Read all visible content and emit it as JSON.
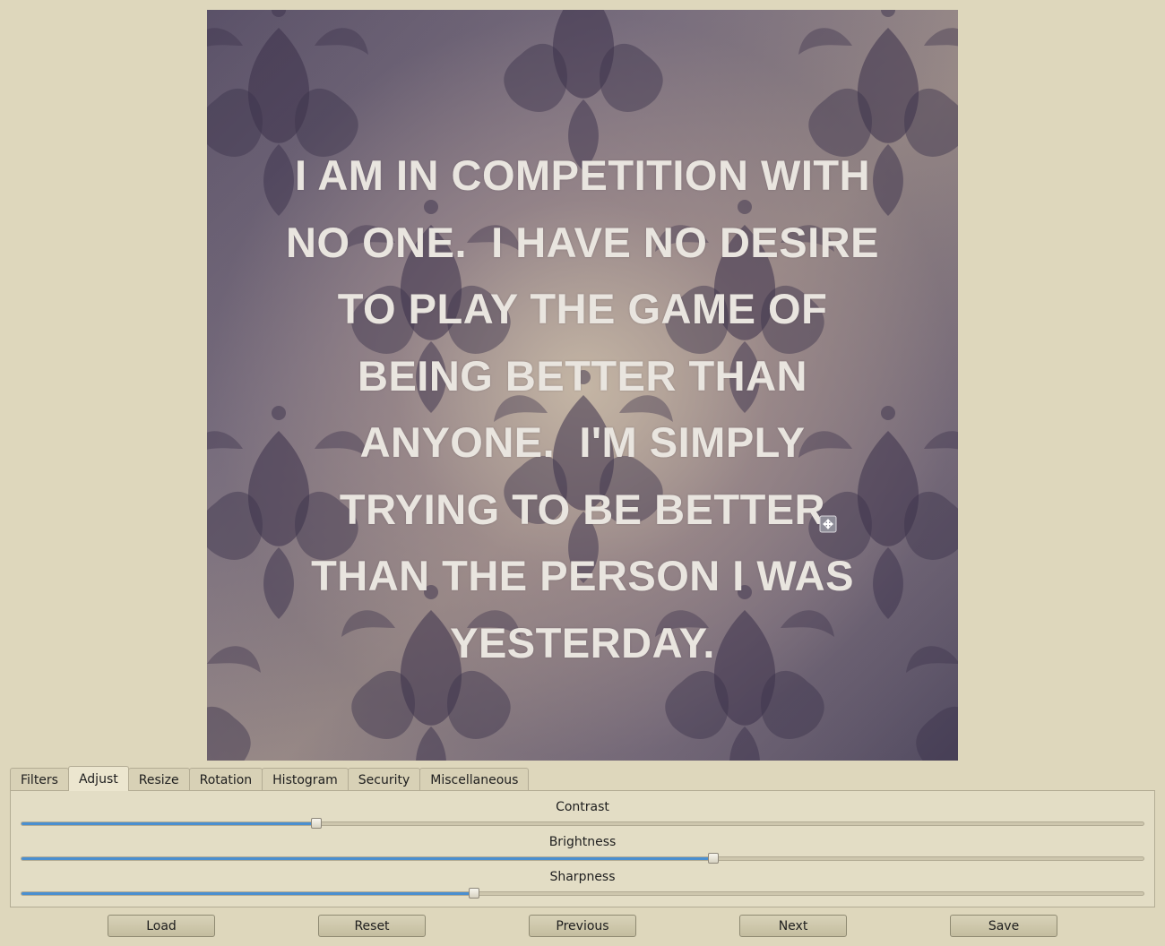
{
  "preview": {
    "quote_lines": [
      "I AM IN COMPETITION WITH",
      "NO ONE.  I HAVE NO DESIRE",
      "TO PLAY THE GAME OF",
      "BEING BETTER THAN",
      "ANYONE.  I'M SIMPLY",
      "TRYING TO BE BETTER",
      "THAN THE PERSON I WAS",
      "YESTERDAY."
    ],
    "cursor_icon": "move-cursor-icon"
  },
  "tabs": [
    {
      "label": "Filters",
      "active": false
    },
    {
      "label": "Adjust",
      "active": true
    },
    {
      "label": "Resize",
      "active": false
    },
    {
      "label": "Rotation",
      "active": false
    },
    {
      "label": "Histogram",
      "active": false
    },
    {
      "label": "Security",
      "active": false
    },
    {
      "label": "Miscellaneous",
      "active": false
    }
  ],
  "adjust": {
    "sliders": [
      {
        "label": "Contrast",
        "value": 0.263
      },
      {
        "label": "Brightness",
        "value": 0.617
      },
      {
        "label": "Sharpness",
        "value": 0.403
      }
    ]
  },
  "buttons": {
    "load": "Load",
    "reset": "Reset",
    "previous": "Previous",
    "next": "Next",
    "save": "Save"
  },
  "colors": {
    "window_bg": "#ded7bc",
    "slider_fill": "#4a8fd0",
    "quote_text": "#e9e5df"
  }
}
